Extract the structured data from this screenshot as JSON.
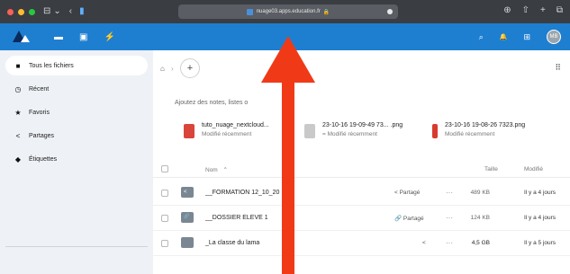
{
  "browser": {
    "url": "nuage03.apps.education.fr",
    "controls": [
      "⊟",
      "⌄",
      "‹"
    ],
    "right_icons": [
      "⊕",
      "⇧",
      "+",
      "⧉"
    ]
  },
  "header": {
    "brand": "Nextcloud",
    "apps": [
      "▬",
      "▣",
      "⚡"
    ],
    "right_icons": [
      "⌕",
      "🔔",
      "⊞"
    ],
    "avatar_initials": "MB"
  },
  "sidebar": {
    "items": [
      {
        "label": "Tous les fichiers",
        "icon": "folder-icon",
        "glyph": "■",
        "active": true
      },
      {
        "label": "Récent",
        "icon": "clock-icon",
        "glyph": "◷",
        "active": false
      },
      {
        "label": "Favoris",
        "icon": "star-icon",
        "glyph": "★",
        "active": false
      },
      {
        "label": "Partages",
        "icon": "share-icon",
        "glyph": "<",
        "active": false
      },
      {
        "label": "Étiquettes",
        "icon": "tag-icon",
        "glyph": "◆",
        "active": false
      }
    ]
  },
  "main": {
    "breadcrumb_home": "⌂",
    "breadcrumb_sep": "›",
    "add_label": "+",
    "view_toggle": "⠿",
    "notes_text": "Ajoutez des notes, listes o",
    "recent": [
      {
        "name": "tuto_nuage_nextcloud...",
        "sub": "Modifié récemment",
        "color": "#d9443b"
      },
      {
        "name": "23-10-16 19-09-49 73... .png",
        "sub": "= Modifié récemment",
        "color": "#c9c9c9"
      },
      {
        "name": "23-10-16 19-08-26 7323.png",
        "sub": "Modifié récemment",
        "color": "#d93a2e"
      }
    ],
    "columns": {
      "name": "Nom",
      "sort": "⌃",
      "size": "Taille",
      "modified": "Modifié"
    },
    "files": [
      {
        "name": "__FORMATION 12_10_20",
        "share": "< Partagé",
        "dots": "···",
        "size": "489 KB",
        "modified": "Il y a 4 jours",
        "glyph": "<"
      },
      {
        "name": "__DOSSIER ELEVE 1",
        "share": "🔗 Partagé",
        "dots": "···",
        "size": "124 KB",
        "modified": "Il y a 4 jours",
        "glyph": "🔗"
      },
      {
        "name": "_La classe du lama",
        "share": "<",
        "dots": "···",
        "size": "4,5 GB",
        "modified": "Il y a 5 jours",
        "glyph": ""
      }
    ]
  },
  "colors": {
    "header": "#1e7fd1",
    "sidebar": "#eef1f5",
    "arrow": "#f03a17"
  }
}
